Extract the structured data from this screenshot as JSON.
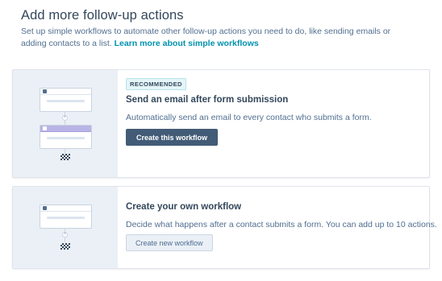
{
  "header": {
    "title": "Add more follow-up actions",
    "intro_text": "Set up simple workflows to automate other follow-up actions you need to do, like sending emails or adding contacts to a list.",
    "learn_more_link": "Learn more about simple workflows"
  },
  "cards": [
    {
      "badge": "RECOMMENDED",
      "title": "Send an email after form submission",
      "description": "Automatically send an email to every contact who submits a form.",
      "button_label": "Create this workflow"
    },
    {
      "title": "Create your own workflow",
      "description": "Decide what happens after a contact submits a form. You can add up to 10 actions.",
      "button_label": "Create new workflow"
    }
  ],
  "icons": {
    "trigger": "contact-icon",
    "action": "email-icon",
    "add": "plus-icon",
    "end": "finish-flag-icon"
  },
  "colors": {
    "title_text": "#33475b",
    "body_text": "#516f90",
    "link": "#0091ae",
    "primary_button": "#425b76",
    "illustration_bg": "#eaf0f6",
    "action_header": "#b9b4e6",
    "badge_bg": "#e5f5f8"
  }
}
